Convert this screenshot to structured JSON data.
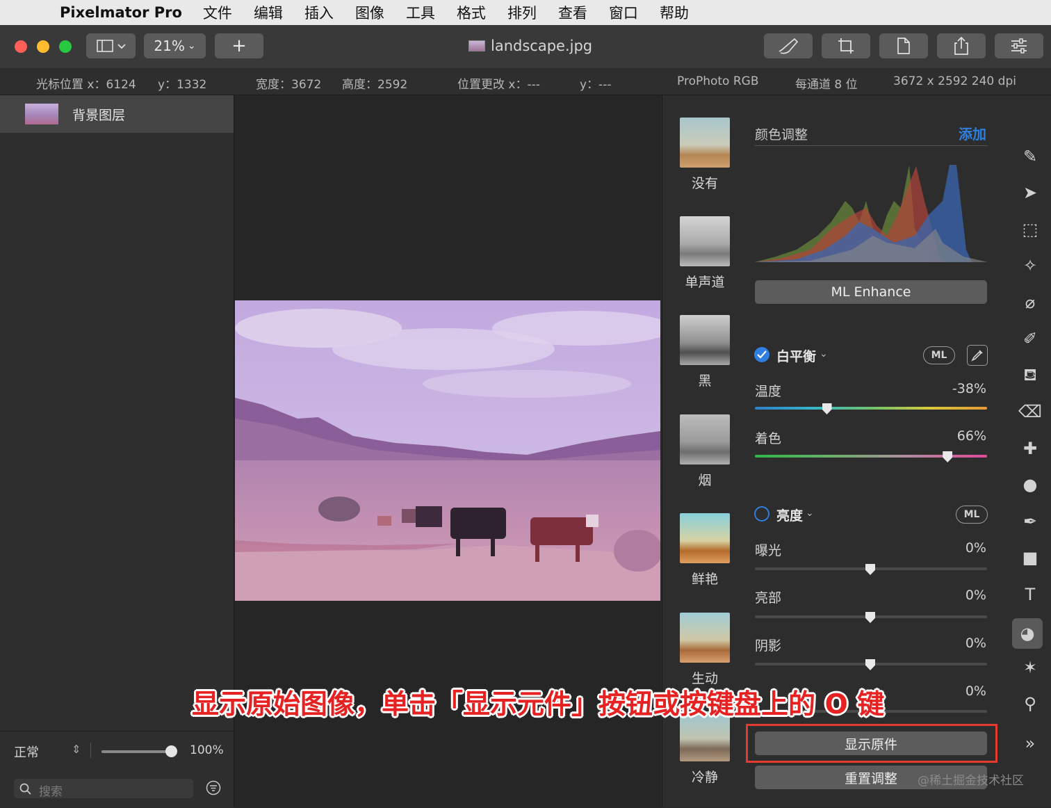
{
  "menubar": {
    "app_name": "Pixelmator Pro",
    "items": [
      "文件",
      "编辑",
      "插入",
      "图像",
      "工具",
      "格式",
      "排列",
      "查看",
      "窗口",
      "帮助"
    ]
  },
  "toolbar": {
    "zoom": "21%",
    "add": "+",
    "document_title": "landscape.jpg"
  },
  "infobar": {
    "cursor_x": "光标位置 x：6124",
    "cursor_y": "y：1332",
    "width": "宽度：3672",
    "height": "高度：2592",
    "pos_x": "位置更改 x：---",
    "pos_y": "y：---",
    "color_profile": "ProPhoto RGB",
    "bit_depth": "每通道 8 位",
    "dimensions": "3672 x 2592 240 dpi"
  },
  "layers": {
    "items": [
      {
        "name": "背景图层"
      }
    ],
    "blend_mode": "正常",
    "opacity": "100%",
    "opacity_value": 1.0,
    "search_placeholder": "搜索"
  },
  "presets": [
    "没有",
    "单声道",
    "黑",
    "烟",
    "鲜艳",
    "生动",
    "冷静"
  ],
  "adjustments": {
    "section_title": "颜色调整",
    "add_label": "添加",
    "ml_enhance": "ML Enhance",
    "white_balance": {
      "title": "白平衡",
      "enabled": true,
      "ml": "ML",
      "temperature": {
        "label": "温度",
        "value": "-38%",
        "level": -0.38
      },
      "tint": {
        "label": "着色",
        "value": "66%",
        "level": 0.66
      }
    },
    "brightness": {
      "title": "亮度",
      "enabled": false,
      "ml": "ML",
      "exposure": {
        "label": "曝光",
        "value": "0%"
      },
      "highlights": {
        "label": "亮部",
        "value": "0%"
      },
      "shadows": {
        "label": "阴影",
        "value": "0%"
      },
      "fourth_value": "0%"
    },
    "show_original": "显示原件",
    "reset": "重置调整"
  },
  "colors": {
    "accent": "#2f7fe0",
    "highlight_box": "#e43a32",
    "caption": "#e62121"
  },
  "overlay": {
    "caption": "显示原始图像，单击「显示元件」按钮或按键盘上的 O 键",
    "watermark": "@稀土掘金技术社区"
  }
}
